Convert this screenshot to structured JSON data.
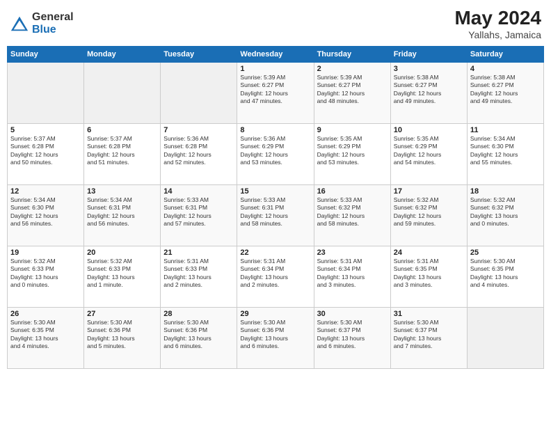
{
  "header": {
    "logo_general": "General",
    "logo_blue": "Blue",
    "title": "May 2024",
    "location": "Yallahs, Jamaica"
  },
  "weekdays": [
    "Sunday",
    "Monday",
    "Tuesday",
    "Wednesday",
    "Thursday",
    "Friday",
    "Saturday"
  ],
  "weeks": [
    [
      {
        "day": "",
        "info": ""
      },
      {
        "day": "",
        "info": ""
      },
      {
        "day": "",
        "info": ""
      },
      {
        "day": "1",
        "info": "Sunrise: 5:39 AM\nSunset: 6:27 PM\nDaylight: 12 hours\nand 47 minutes."
      },
      {
        "day": "2",
        "info": "Sunrise: 5:39 AM\nSunset: 6:27 PM\nDaylight: 12 hours\nand 48 minutes."
      },
      {
        "day": "3",
        "info": "Sunrise: 5:38 AM\nSunset: 6:27 PM\nDaylight: 12 hours\nand 49 minutes."
      },
      {
        "day": "4",
        "info": "Sunrise: 5:38 AM\nSunset: 6:27 PM\nDaylight: 12 hours\nand 49 minutes."
      }
    ],
    [
      {
        "day": "5",
        "info": "Sunrise: 5:37 AM\nSunset: 6:28 PM\nDaylight: 12 hours\nand 50 minutes."
      },
      {
        "day": "6",
        "info": "Sunrise: 5:37 AM\nSunset: 6:28 PM\nDaylight: 12 hours\nand 51 minutes."
      },
      {
        "day": "7",
        "info": "Sunrise: 5:36 AM\nSunset: 6:28 PM\nDaylight: 12 hours\nand 52 minutes."
      },
      {
        "day": "8",
        "info": "Sunrise: 5:36 AM\nSunset: 6:29 PM\nDaylight: 12 hours\nand 53 minutes."
      },
      {
        "day": "9",
        "info": "Sunrise: 5:35 AM\nSunset: 6:29 PM\nDaylight: 12 hours\nand 53 minutes."
      },
      {
        "day": "10",
        "info": "Sunrise: 5:35 AM\nSunset: 6:29 PM\nDaylight: 12 hours\nand 54 minutes."
      },
      {
        "day": "11",
        "info": "Sunrise: 5:34 AM\nSunset: 6:30 PM\nDaylight: 12 hours\nand 55 minutes."
      }
    ],
    [
      {
        "day": "12",
        "info": "Sunrise: 5:34 AM\nSunset: 6:30 PM\nDaylight: 12 hours\nand 56 minutes."
      },
      {
        "day": "13",
        "info": "Sunrise: 5:34 AM\nSunset: 6:31 PM\nDaylight: 12 hours\nand 56 minutes."
      },
      {
        "day": "14",
        "info": "Sunrise: 5:33 AM\nSunset: 6:31 PM\nDaylight: 12 hours\nand 57 minutes."
      },
      {
        "day": "15",
        "info": "Sunrise: 5:33 AM\nSunset: 6:31 PM\nDaylight: 12 hours\nand 58 minutes."
      },
      {
        "day": "16",
        "info": "Sunrise: 5:33 AM\nSunset: 6:32 PM\nDaylight: 12 hours\nand 58 minutes."
      },
      {
        "day": "17",
        "info": "Sunrise: 5:32 AM\nSunset: 6:32 PM\nDaylight: 12 hours\nand 59 minutes."
      },
      {
        "day": "18",
        "info": "Sunrise: 5:32 AM\nSunset: 6:32 PM\nDaylight: 13 hours\nand 0 minutes."
      }
    ],
    [
      {
        "day": "19",
        "info": "Sunrise: 5:32 AM\nSunset: 6:33 PM\nDaylight: 13 hours\nand 0 minutes."
      },
      {
        "day": "20",
        "info": "Sunrise: 5:32 AM\nSunset: 6:33 PM\nDaylight: 13 hours\nand 1 minute."
      },
      {
        "day": "21",
        "info": "Sunrise: 5:31 AM\nSunset: 6:33 PM\nDaylight: 13 hours\nand 2 minutes."
      },
      {
        "day": "22",
        "info": "Sunrise: 5:31 AM\nSunset: 6:34 PM\nDaylight: 13 hours\nand 2 minutes."
      },
      {
        "day": "23",
        "info": "Sunrise: 5:31 AM\nSunset: 6:34 PM\nDaylight: 13 hours\nand 3 minutes."
      },
      {
        "day": "24",
        "info": "Sunrise: 5:31 AM\nSunset: 6:35 PM\nDaylight: 13 hours\nand 3 minutes."
      },
      {
        "day": "25",
        "info": "Sunrise: 5:30 AM\nSunset: 6:35 PM\nDaylight: 13 hours\nand 4 minutes."
      }
    ],
    [
      {
        "day": "26",
        "info": "Sunrise: 5:30 AM\nSunset: 6:35 PM\nDaylight: 13 hours\nand 4 minutes."
      },
      {
        "day": "27",
        "info": "Sunrise: 5:30 AM\nSunset: 6:36 PM\nDaylight: 13 hours\nand 5 minutes."
      },
      {
        "day": "28",
        "info": "Sunrise: 5:30 AM\nSunset: 6:36 PM\nDaylight: 13 hours\nand 6 minutes."
      },
      {
        "day": "29",
        "info": "Sunrise: 5:30 AM\nSunset: 6:36 PM\nDaylight: 13 hours\nand 6 minutes."
      },
      {
        "day": "30",
        "info": "Sunrise: 5:30 AM\nSunset: 6:37 PM\nDaylight: 13 hours\nand 6 minutes."
      },
      {
        "day": "31",
        "info": "Sunrise: 5:30 AM\nSunset: 6:37 PM\nDaylight: 13 hours\nand 7 minutes."
      },
      {
        "day": "",
        "info": ""
      }
    ]
  ]
}
